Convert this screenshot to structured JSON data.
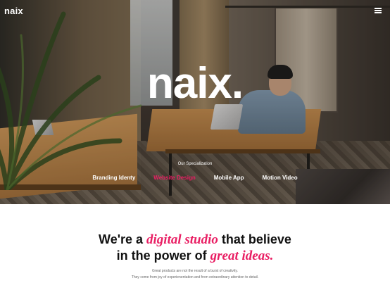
{
  "header": {
    "logo": "naix",
    "menu_icon": "hamburger-menu-icon"
  },
  "hero": {
    "title": "naix.",
    "specialization_label": "Our Specialization",
    "nav": [
      {
        "label": "Branding Identy",
        "active": false
      },
      {
        "label": "Website Design",
        "active": true
      },
      {
        "label": "Mobile App",
        "active": false
      },
      {
        "label": "Motion Video",
        "active": false
      }
    ]
  },
  "intro": {
    "line1_a": "We're a ",
    "line1_em": "digital studio",
    "line1_b": " that believe",
    "line2_a": "in the power of ",
    "line2_em": "great ideas.",
    "sub1": "Great products are not the result of a burst of creativity.",
    "sub2": "They come from joy of experienentation and from extraordinary attention to detail."
  },
  "colors": {
    "accent": "#e91e63",
    "text": "#111111"
  }
}
